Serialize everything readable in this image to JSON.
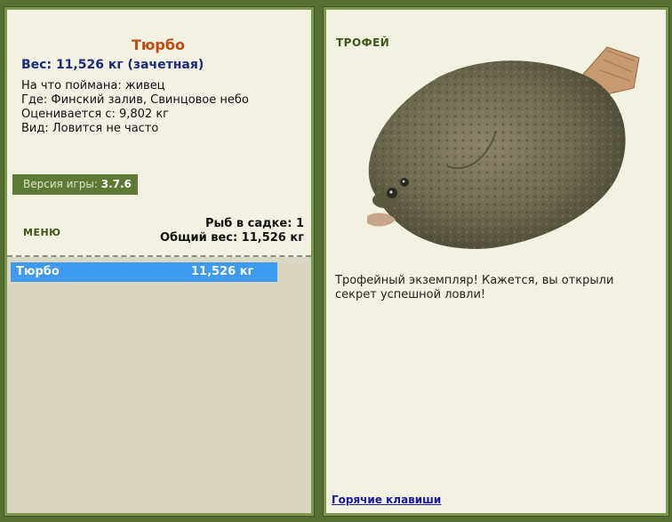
{
  "catch": {
    "name": "Тюрбо",
    "weight_line": "Вес: 11,526 кг (зачетная)",
    "bait_line": "На что поймана: живец",
    "location_line": "Где: Финский залив, Свинцовое небо",
    "value_line": "Оценивается с: 9,802 кг",
    "frequency_line": "Вид: Ловится не часто"
  },
  "version": {
    "label": "Версия игры:",
    "value": "3.7.6"
  },
  "menu_label": "МЕНЮ",
  "tank": {
    "fish_count_line": "Рыб в садке: 1",
    "total_weight_line": "Общий вес: 11,526 кг"
  },
  "fish_list": [
    {
      "name": "Тюрбо",
      "weight": "11,526 кг"
    }
  ],
  "trophy": {
    "label": "ТРОФЕЙ",
    "message": "Трофейный экземпляр! Кажется, вы открыли секрет успешной ловли!"
  },
  "hotkeys_link": "Горячие клавиши",
  "colors": {
    "background": "#566f33",
    "panel": "#f3f1e1",
    "list_selected": "#3d9af0",
    "fish_name": "#c04a10"
  }
}
